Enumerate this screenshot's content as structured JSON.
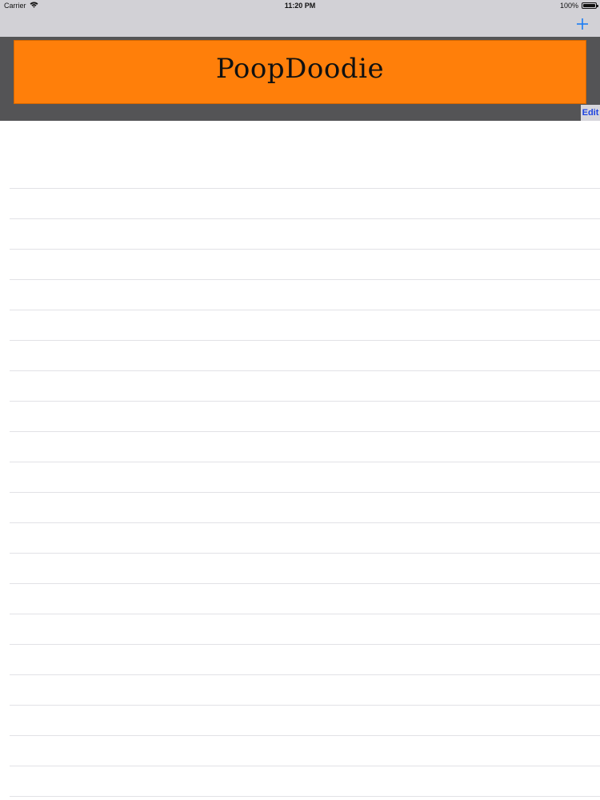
{
  "status_bar": {
    "carrier": "Carrier",
    "time": "11:20 PM",
    "battery": "100%",
    "icons": {
      "wifi": "wifi-icon",
      "battery": "battery-icon"
    }
  },
  "nav_bar": {
    "add_icon": "plus-icon",
    "accent_color": "#1a7cf5"
  },
  "header": {
    "title": "PoopDoodie",
    "banner_color": "#ff7f0a",
    "band_color": "#545456",
    "edit_label": "Edit",
    "edit_color": "#1d43e0"
  },
  "table": {
    "row_count": 22
  }
}
